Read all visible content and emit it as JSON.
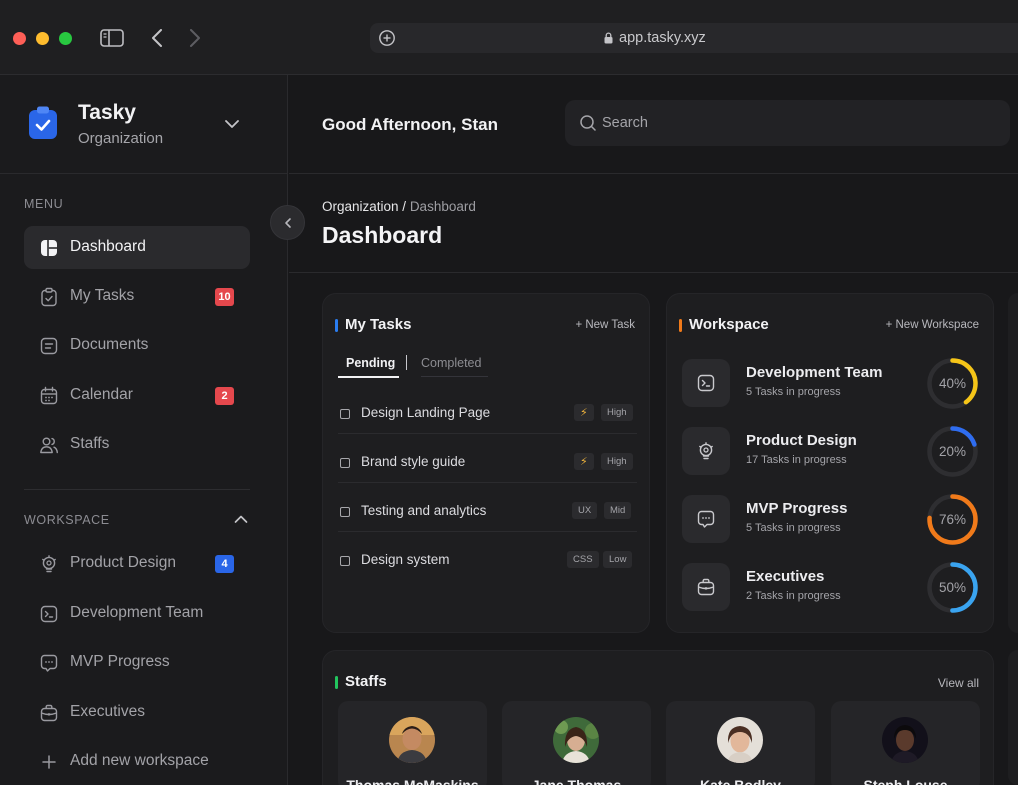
{
  "browser": {
    "url": "app.tasky.xyz"
  },
  "brand": {
    "name": "Tasky",
    "subtitle": "Organization"
  },
  "sidebar": {
    "menu_label": "MENU",
    "menu_items": [
      {
        "label": "Dashboard",
        "icon": "dashboard-icon",
        "active": true
      },
      {
        "label": "My Tasks",
        "icon": "clipboard-check-icon",
        "badge": "10"
      },
      {
        "label": "Documents",
        "icon": "document-icon"
      },
      {
        "label": "Calendar",
        "icon": "calendar-icon",
        "badge": "2"
      },
      {
        "label": "Staffs",
        "icon": "users-icon"
      }
    ],
    "workspace_label": "WORKSPACE",
    "workspace_items": [
      {
        "label": "Product Design",
        "icon": "bulb-gear-icon",
        "badge": "4"
      },
      {
        "label": "Development Team",
        "icon": "terminal-icon"
      },
      {
        "label": "MVP Progress",
        "icon": "chat-dots-icon"
      },
      {
        "label": "Executives",
        "icon": "briefcase-icon"
      }
    ],
    "add_workspace": "Add new workspace"
  },
  "header": {
    "greeting": "Good Afternoon, Stan",
    "search_placeholder": "Search"
  },
  "breadcrumb": {
    "root": "Organization /",
    "current": "Dashboard"
  },
  "page_title": "Dashboard",
  "tasks_card": {
    "title": "My Tasks",
    "action": "+ New Task",
    "tab_pending": "Pending",
    "tab_completed": "Completed",
    "tasks": [
      {
        "name": "Design Landing Page",
        "tags": [
          "⚡",
          "High"
        ]
      },
      {
        "name": "Brand style guide",
        "tags": [
          "⚡",
          "High"
        ]
      },
      {
        "name": "Testing and analytics",
        "tags": [
          "UX",
          "Mid"
        ]
      },
      {
        "name": "Design system",
        "tags": [
          "CSS",
          "Low"
        ]
      }
    ]
  },
  "workspace_card": {
    "title": "Workspace",
    "action": "+ New Workspace",
    "items": [
      {
        "name": "Development Team",
        "sub": "5 Tasks in progress",
        "percent": 40,
        "percent_label": "40%",
        "color": "#f5c518",
        "icon": "terminal-icon"
      },
      {
        "name": "Product Design",
        "sub": "17 Tasks in progress",
        "percent": 20,
        "percent_label": "20%",
        "color": "#2f6df0",
        "icon": "bulb-gear-icon"
      },
      {
        "name": "MVP Progress",
        "sub": "5 Tasks in progress",
        "percent": 76,
        "percent_label": "76%",
        "color": "#f07a1a",
        "icon": "chat-dots-icon"
      },
      {
        "name": "Executives",
        "sub": "2 Tasks in progress",
        "percent": 50,
        "percent_label": "50%",
        "color": "#3aa4f0",
        "icon": "briefcase-icon"
      }
    ]
  },
  "staffs_card": {
    "title": "Staffs",
    "action": "View all",
    "staff": [
      {
        "name": "Thomas McMaskins"
      },
      {
        "name": "Jane Thomas"
      },
      {
        "name": "Kate Bodley"
      },
      {
        "name": "Steph Louse"
      }
    ]
  },
  "colors": {
    "accent_blue": "#2a66e8",
    "tasks_bar": "#2a7df0",
    "workspace_bar": "#f07a1a",
    "staffs_bar": "#22c55e",
    "badge_red": "#e5484d"
  }
}
